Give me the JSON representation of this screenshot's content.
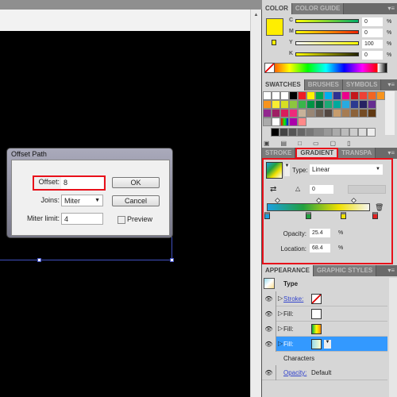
{
  "dialog": {
    "title": "Offset Path",
    "offset_label": "Offset:",
    "offset_value": "8",
    "joins_label": "Joins:",
    "joins_value": "Miter",
    "miter_label": "Miter limit:",
    "miter_value": "4",
    "ok": "OK",
    "cancel": "Cancel",
    "preview": "Preview",
    "preview_checked": false
  },
  "color_panel": {
    "tabs": [
      "COLOR",
      "COLOR GUIDE"
    ],
    "fill_color": "#ffee00",
    "channels": [
      {
        "label": "C",
        "value": "0",
        "unit": "%"
      },
      {
        "label": "M",
        "value": "0",
        "unit": "%"
      },
      {
        "label": "Y",
        "value": "100",
        "unit": "%"
      },
      {
        "label": "K",
        "value": "0",
        "unit": "%"
      }
    ]
  },
  "swatches_panel": {
    "tabs": [
      "SWATCHES",
      "BRUSHES",
      "SYMBOLS"
    ],
    "rows": [
      [
        "#ffffff",
        "#ffffff",
        "#ffffff",
        "#000000",
        "#ee1c24",
        "#fff200",
        "#00a651",
        "#00aeef",
        "#2e3192",
        "#ec008c",
        "#c4161c",
        "#ef4136",
        "#f26522",
        "#f7941d"
      ],
      [
        "#f7941d",
        "#f9ed32",
        "#d7df23",
        "#8dc63f",
        "#39b54a",
        "#009444",
        "#006838",
        "#1ba975",
        "#00a99d",
        "#27aae1",
        "#2b3990",
        "#262262",
        "#662d91"
      ],
      [
        "#92278f",
        "#9e1f63",
        "#da1c5c",
        "#ee2a7b",
        "#c7b299",
        "#998675",
        "#736357",
        "#534741",
        "#c69c6d",
        "#a67c52",
        "#8c6239",
        "#754c24",
        "#603913"
      ]
    ]
  },
  "gradient_panel": {
    "tabs": [
      "STROKE",
      "GRADIENT",
      "TRANSPA"
    ],
    "type_label": "Type:",
    "type_value": "Linear",
    "angle_value": "0",
    "opacity_label": "Opacity:",
    "opacity_value": "25.4",
    "location_label": "Location:",
    "location_value": "68.4",
    "unit": "%",
    "stops": [
      "#1ba0e0",
      "#22a040",
      "#f0e000",
      "#e02020"
    ]
  },
  "appearance_panel": {
    "tabs": [
      "APPEARANCE",
      "GRAPHIC STYLES"
    ],
    "type_label": "Type",
    "rows": [
      {
        "label": "Stroke:",
        "link": true
      },
      {
        "label": "Fill:"
      },
      {
        "label": "Fill:"
      },
      {
        "label": "Fill:",
        "selected": true
      }
    ],
    "characters": "Characters",
    "opacity_label": "Opacity:",
    "opacity_value": "Default"
  },
  "colors": {
    "highlight": "#e8101a",
    "selection": "#3399ff"
  }
}
